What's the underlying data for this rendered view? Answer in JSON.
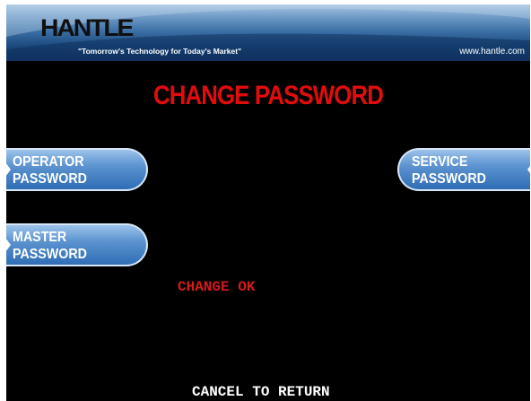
{
  "header": {
    "logo": "HANTLE",
    "tagline": "\"Tomorrow's Technology for Today's Market\"",
    "website": "www.hantle.com"
  },
  "screen": {
    "title": "CHANGE PASSWORD",
    "status": "CHANGE OK",
    "footer": "CANCEL TO RETURN"
  },
  "buttons": {
    "operator": {
      "line1": "OPERATOR",
      "line2": "PASSWORD"
    },
    "master": {
      "line1": "MASTER",
      "line2": "PASSWORD"
    },
    "service": {
      "line1": "SERVICE",
      "line2": "PASSWORD"
    }
  },
  "colors": {
    "title": "#e30c0c",
    "status": "#d21b1b",
    "button": "#2f6db4",
    "background": "#000000"
  }
}
